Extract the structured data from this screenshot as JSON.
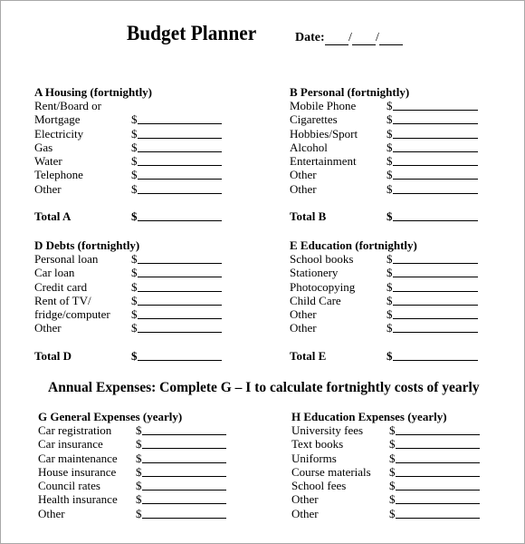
{
  "header": {
    "title": "Budget Planner",
    "date_label": "Date:",
    "date_separator": "/"
  },
  "sections": {
    "A": {
      "title": "A  Housing (fortnightly)",
      "items": [
        {
          "label": "Rent/Board or",
          "has_field": false
        },
        {
          "label": "Mortgage",
          "has_field": true
        },
        {
          "label": "Electricity",
          "has_field": true
        },
        {
          "label": "Gas",
          "has_field": true
        },
        {
          "label": "Water",
          "has_field": true
        },
        {
          "label": "Telephone",
          "has_field": true
        },
        {
          "label": "Other",
          "has_field": true
        }
      ],
      "total_label": "Total A"
    },
    "B": {
      "title": "B  Personal (fortnightly)",
      "items": [
        {
          "label": "Mobile Phone",
          "has_field": true
        },
        {
          "label": "Cigarettes",
          "has_field": true
        },
        {
          "label": "Hobbies/Sport",
          "has_field": true
        },
        {
          "label": "Alcohol",
          "has_field": true
        },
        {
          "label": "Entertainment",
          "has_field": true
        },
        {
          "label": "Other",
          "has_field": true
        },
        {
          "label": "Other",
          "has_field": true
        }
      ],
      "total_label": "Total B"
    },
    "D": {
      "title": "D  Debts (fortnightly)",
      "items": [
        {
          "label": "Personal loan",
          "has_field": true
        },
        {
          "label": "Car loan",
          "has_field": true
        },
        {
          "label": "Credit card",
          "has_field": true
        },
        {
          "label": "Rent of TV/",
          "has_field": true
        },
        {
          "label": "fridge/computer",
          "has_field": true
        },
        {
          "label": "Other",
          "has_field": true
        }
      ],
      "total_label": "Total D"
    },
    "E": {
      "title": "E  Education (fortnightly)",
      "items": [
        {
          "label": "School books",
          "has_field": true
        },
        {
          "label": "Stationery",
          "has_field": true
        },
        {
          "label": "Photocopying",
          "has_field": true
        },
        {
          "label": "Child Care",
          "has_field": true
        },
        {
          "label": "Other",
          "has_field": true
        },
        {
          "label": "Other",
          "has_field": true
        }
      ],
      "total_label": "Total E"
    },
    "G": {
      "title": "G  General Expenses (yearly)",
      "items": [
        {
          "label": "Car registration",
          "has_field": true
        },
        {
          "label": "Car insurance",
          "has_field": true
        },
        {
          "label": "Car maintenance",
          "has_field": true
        },
        {
          "label": "House insurance",
          "has_field": true
        },
        {
          "label": "Council rates",
          "has_field": true
        },
        {
          "label": "Health insurance",
          "has_field": true
        },
        {
          "label": "Other",
          "has_field": true
        }
      ]
    },
    "H": {
      "title": "H  Education Expenses (yearly)",
      "items": [
        {
          "label": "University fees",
          "has_field": true
        },
        {
          "label": "Text books",
          "has_field": true
        },
        {
          "label": "Uniforms",
          "has_field": true
        },
        {
          "label": "Course materials",
          "has_field": true
        },
        {
          "label": "School fees",
          "has_field": true
        },
        {
          "label": "Other",
          "has_field": true
        },
        {
          "label": "Other",
          "has_field": true
        }
      ]
    }
  },
  "annual_heading": "Annual Expenses:  Complete G – I to calculate fortnightly costs of yearly",
  "currency_symbol": "$"
}
